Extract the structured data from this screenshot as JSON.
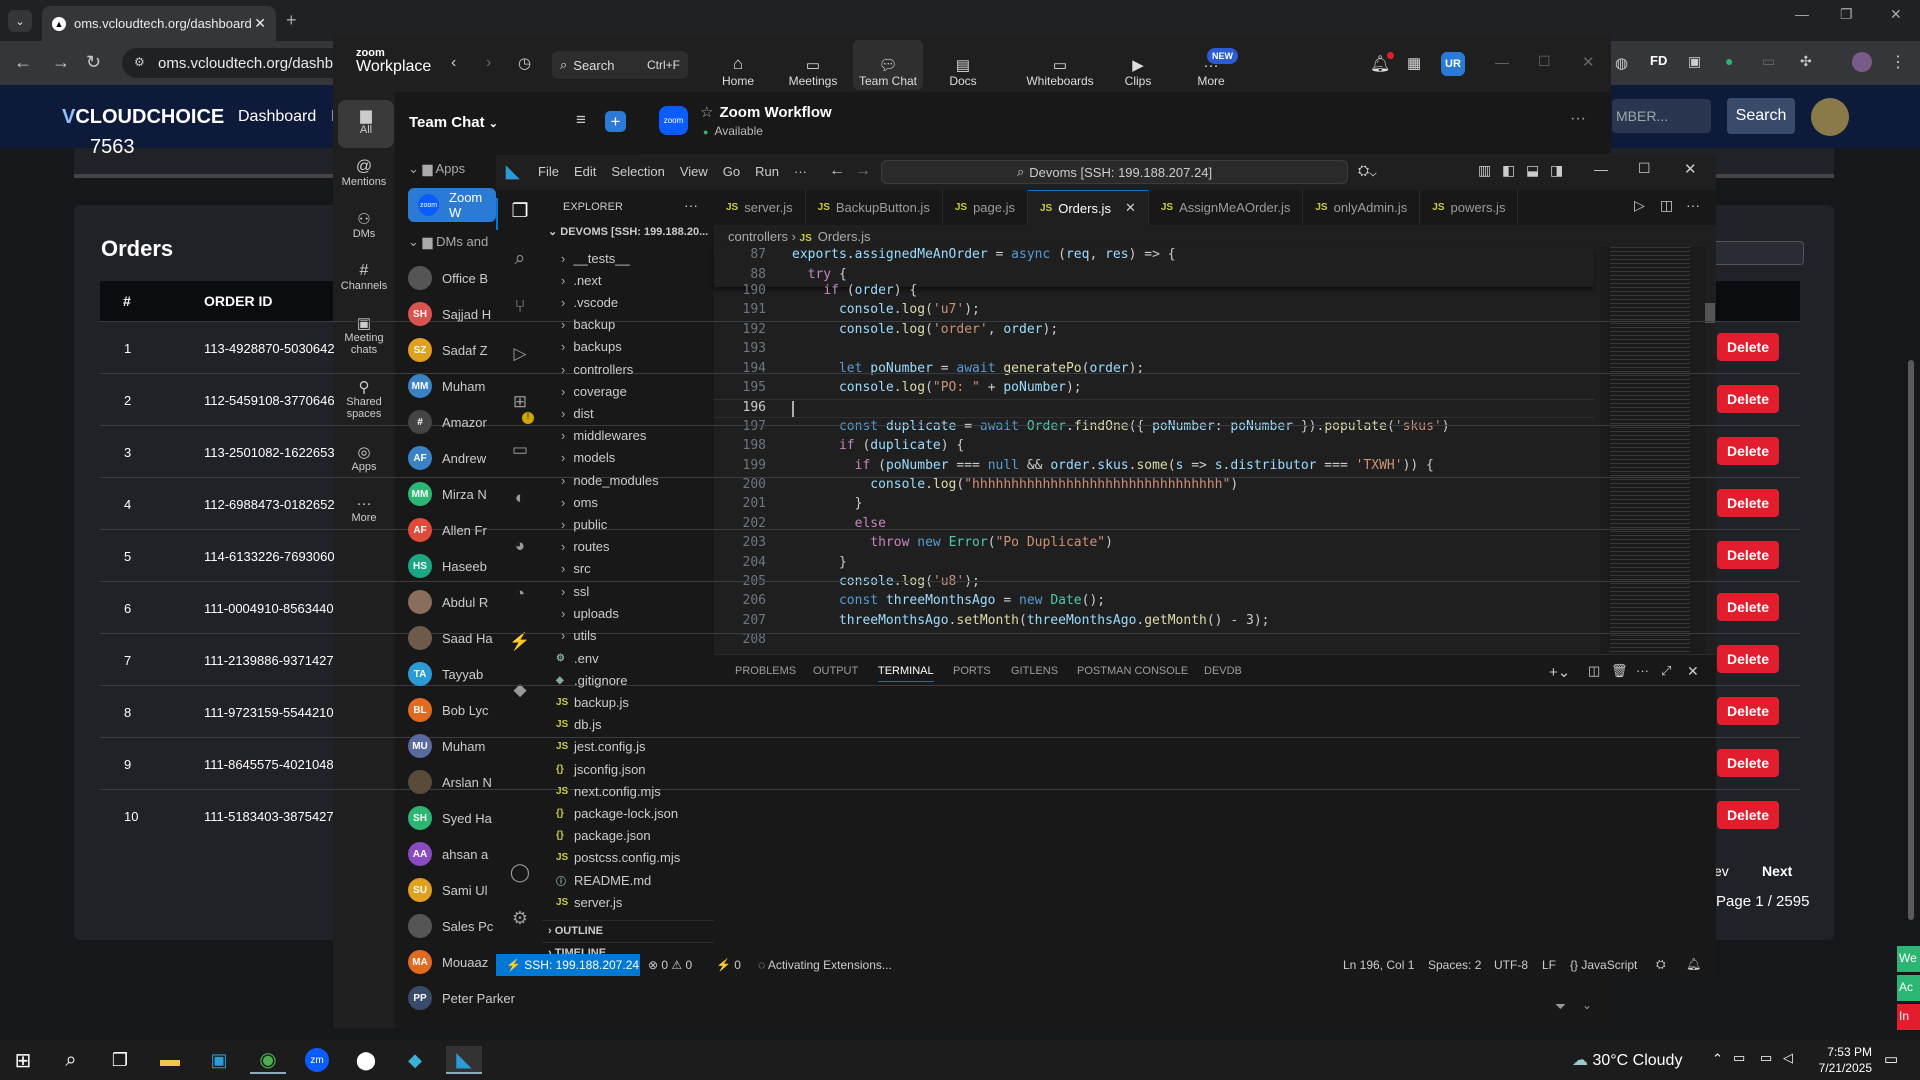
{
  "browser": {
    "tab_title": "oms.vcloudtech.org/dashboard",
    "url": "oms.vcloudtech.org/dashbo"
  },
  "site": {
    "logo": "CLOUDCHOICE",
    "nav_dashboard": "Dashboard",
    "nav_partial": "I",
    "search_placeholder": "MBER...",
    "search_button": "Search",
    "above_card_number": "7563",
    "orders_title": "Orders",
    "col_num": "#",
    "col_order_id": "ORDER ID",
    "search_partial": "h",
    "rows": [
      {
        "n": "1",
        "id": "113-4928870-5030642"
      },
      {
        "n": "2",
        "id": "112-5459108-3770646"
      },
      {
        "n": "3",
        "id": "113-2501082-1622653"
      },
      {
        "n": "4",
        "id": "112-6988473-0182652"
      },
      {
        "n": "5",
        "id": "114-6133226-7693060"
      },
      {
        "n": "6",
        "id": "111-0004910-8563440"
      },
      {
        "n": "7",
        "id": "111-2139886-9371427"
      },
      {
        "n": "8",
        "id": "111-9723159-5544210"
      },
      {
        "n": "9",
        "id": "111-8645575-4021048"
      },
      {
        "n": "10",
        "id": "111-5183403-3875427"
      }
    ],
    "delete_label": "Delete",
    "prev_partial": "ev",
    "next_label": "Next",
    "page_info": "Page 1 / 2595",
    "side_badges": [
      "We",
      "Ac",
      "In"
    ]
  },
  "zoom": {
    "brand_top": "zoom",
    "brand_bottom": "Workplace",
    "search_label": "Search",
    "search_shortcut": "Ctrl+F",
    "nav": [
      "Home",
      "Meetings",
      "Team Chat",
      "Docs",
      "Whiteboards",
      "Clips",
      "More"
    ],
    "new_badge": "NEW",
    "user_initials": "UR",
    "rail": [
      "All",
      "Mentions",
      "DMs",
      "Channels",
      "Meeting chats",
      "Shared spaces",
      "Apps",
      "More"
    ],
    "list_title": "Team Chat",
    "apps_section": "Apps",
    "zoom_app": "Zoom W",
    "dms_section": "DMs and",
    "chats": [
      {
        "initials": "",
        "name": "Office B",
        "color": "#555555"
      },
      {
        "initials": "SH",
        "name": "Sajjad H",
        "color": "#d9534f"
      },
      {
        "initials": "SZ",
        "name": "Sadaf Z",
        "color": "#e0a020"
      },
      {
        "initials": "MM",
        "name": "Muham",
        "color": "#3b82c4"
      },
      {
        "initials": "#",
        "name": "Amazor",
        "color": "#444444"
      },
      {
        "initials": "AF",
        "name": "Andrew",
        "color": "#3b82c4"
      },
      {
        "initials": "MM",
        "name": "Mirza N",
        "color": "#2bb673"
      },
      {
        "initials": "AF",
        "name": "Allen Fr",
        "color": "#e04a3a"
      },
      {
        "initials": "HS",
        "name": "Haseeb",
        "color": "#1ba784"
      },
      {
        "initials": "",
        "name": "Abdul R",
        "color": "#8a6d5a"
      },
      {
        "initials": "",
        "name": "Saad Ha",
        "color": "#6d5a4a"
      },
      {
        "initials": "TA",
        "name": "Tayyab",
        "color": "#2b9bd8"
      },
      {
        "initials": "BL",
        "name": "Bob Lyc",
        "color": "#e06a20"
      },
      {
        "initials": "MU",
        "name": "Muham",
        "color": "#5a6aa0"
      },
      {
        "initials": "",
        "name": "Arslan N",
        "color": "#5a4a3a"
      },
      {
        "initials": "SH",
        "name": "Syed Ha",
        "color": "#2bb673"
      },
      {
        "initials": "AA",
        "name": "ahsan a",
        "color": "#8a4ac0"
      },
      {
        "initials": "SU",
        "name": "Sami Ul",
        "color": "#e0a020"
      },
      {
        "initials": "",
        "name": "Sales Pc",
        "color": "#555555"
      },
      {
        "initials": "MA",
        "name": "Mouaaz",
        "color": "#e06a20"
      },
      {
        "initials": "PP",
        "name": "Peter Parker",
        "color": "#3a4a6a"
      }
    ],
    "header_title": "Zoom Workflow",
    "header_status": "Available",
    "zoom_logo_small": "zoom"
  },
  "vscode": {
    "menu": [
      "File",
      "Edit",
      "Selection",
      "View",
      "Go",
      "Run",
      "···"
    ],
    "command_center": "Devoms [SSH: 199.188.207.24]",
    "explorer_title": "EXPLORER",
    "root_folder": "DEVOMS [SSH: 199.188.20...",
    "folders": [
      "__tests__",
      ".next",
      ".vscode",
      "backup",
      "backups",
      "controllers",
      "coverage",
      "dist",
      "middlewares",
      "models",
      "node_modules",
      "oms",
      "public",
      "routes",
      "src",
      "ssl",
      "uploads",
      "utils"
    ],
    "files": [
      {
        "icon": "⚙",
        "name": ".env"
      },
      {
        "icon": "◆",
        "name": ".gitignore"
      },
      {
        "icon": "JS",
        "name": "backup.js"
      },
      {
        "icon": "JS",
        "name": "db.js"
      },
      {
        "icon": "JS",
        "name": "jest.config.js"
      },
      {
        "icon": "{}",
        "name": "jsconfig.json"
      },
      {
        "icon": "JS",
        "name": "next.config.mjs"
      },
      {
        "icon": "{}",
        "name": "package-lock.json"
      },
      {
        "icon": "{}",
        "name": "package.json"
      },
      {
        "icon": "JS",
        "name": "postcss.config.mjs"
      },
      {
        "icon": "ⓘ",
        "name": "README.md"
      },
      {
        "icon": "JS",
        "name": "server.js"
      }
    ],
    "outline": "OUTLINE",
    "timeline": "TIMELINE",
    "tabs": [
      "server.js",
      "BackupButton.js",
      "page.js",
      "Orders.js",
      "AssignMeAOrder.js",
      "onlyAdmin.js",
      "powers.js"
    ],
    "breadcrumb_folder": "controllers",
    "breadcrumb_file": "Orders.js",
    "sticky": [
      {
        "n": "87",
        "code": "exports.assignedMeAnOrder = async (req, res) => {"
      },
      {
        "n": "88",
        "code": "  try {"
      }
    ],
    "lines": [
      {
        "n": "190",
        "code": "    if (order) {"
      },
      {
        "n": "191",
        "code": "      console.log('u7');"
      },
      {
        "n": "192",
        "code": "      console.log('order', order);"
      },
      {
        "n": "193",
        "code": ""
      },
      {
        "n": "194",
        "code": "      let poNumber = await generatePo(order);"
      },
      {
        "n": "195",
        "code": "      console.log(\"PO: \" + poNumber);"
      },
      {
        "n": "196",
        "code": ""
      },
      {
        "n": "197",
        "code": "      const duplicate = await Order.findOne({ poNumber: poNumber }).populate('skus')"
      },
      {
        "n": "198",
        "code": "      if (duplicate) {"
      },
      {
        "n": "199",
        "code": "        if (poNumber === null && order.skus.some(s => s.distributor === 'TXWH')) {"
      },
      {
        "n": "200",
        "code": "          console.log(\"hhhhhhhhhhhhhhhhhhhhhhhhhhhhhhhh\")"
      },
      {
        "n": "201",
        "code": "        }"
      },
      {
        "n": "202",
        "code": "        else"
      },
      {
        "n": "203",
        "code": "          throw new Error(\"Po Duplicate\")"
      },
      {
        "n": "204",
        "code": "      }"
      },
      {
        "n": "205",
        "code": "      console.log('u8');"
      },
      {
        "n": "206",
        "code": "      const threeMonthsAgo = new Date();"
      },
      {
        "n": "207",
        "code": "      threeMonthsAgo.setMonth(threeMonthsAgo.getMonth() - 3);"
      },
      {
        "n": "208",
        "code": ""
      }
    ],
    "panel_tabs": [
      "PROBLEMS",
      "OUTPUT",
      "TERMINAL",
      "PORTS",
      "GITLENS",
      "POSTMAN CONSOLE",
      "DEVDB"
    ],
    "status": {
      "remote": "SSH: 199.188.207.24",
      "problems": "⊗ 0 ⚠ 0",
      "ports": "⚡ 0",
      "activity": "Activating Extensions...",
      "position": "Ln 196, Col 1",
      "spaces": "Spaces: 2",
      "encoding": "UTF-8",
      "eol": "LF",
      "language": "JavaScript"
    }
  },
  "taskbar": {
    "weather": "30°C  Cloudy",
    "time": "7:53 PM",
    "date": "7/21/2025"
  }
}
